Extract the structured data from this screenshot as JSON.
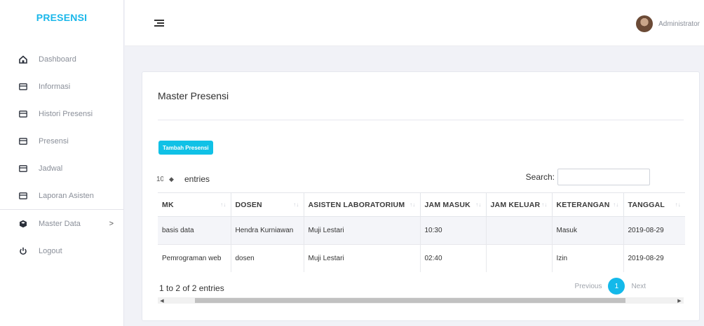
{
  "sidebar": {
    "brand": "PRESENSI",
    "items": [
      {
        "label": "Dashboard",
        "icon": "home-icon"
      },
      {
        "label": "Informasi",
        "icon": "card-icon"
      },
      {
        "label": "Histori Presensi",
        "icon": "card-icon"
      },
      {
        "label": "Presensi",
        "icon": "card-icon"
      },
      {
        "label": "Jadwal",
        "icon": "card-icon"
      },
      {
        "label": "Laporan Asisten",
        "icon": "card-icon"
      },
      {
        "label": "Master Data",
        "icon": "cube-icon",
        "chevron": ">"
      },
      {
        "label": "Logout",
        "icon": "power-icon"
      }
    ]
  },
  "topbar": {
    "user": "Administrator"
  },
  "card": {
    "title": "Master Presensi",
    "add_button": "Tambah Presensi",
    "length": {
      "value": "10",
      "label": "entries"
    },
    "search_label": "Search:",
    "info": "1 to 2 of 2 entries",
    "pager": {
      "prev": "Previous",
      "current": "1",
      "next": "Next"
    }
  },
  "table": {
    "columns": [
      "MK",
      "DOSEN",
      "ASISTEN LABORATORIUM",
      "JAM MASUK",
      "JAM KELUAR",
      "KETERANGAN",
      "TANGGAL"
    ],
    "rows": [
      [
        "basis data",
        "Hendra Kurniawan",
        "Muji Lestari",
        "10:30",
        "",
        "Masuk",
        "2019-08-29"
      ],
      [
        "Pemrograman web",
        "dosen",
        "Muji Lestari",
        "02:40",
        "",
        "Izin",
        "2019-08-29"
      ]
    ]
  },
  "colors": {
    "brand": "#1ab7ea",
    "button": "#10c1e6",
    "pager_active": "#14b9ea"
  }
}
